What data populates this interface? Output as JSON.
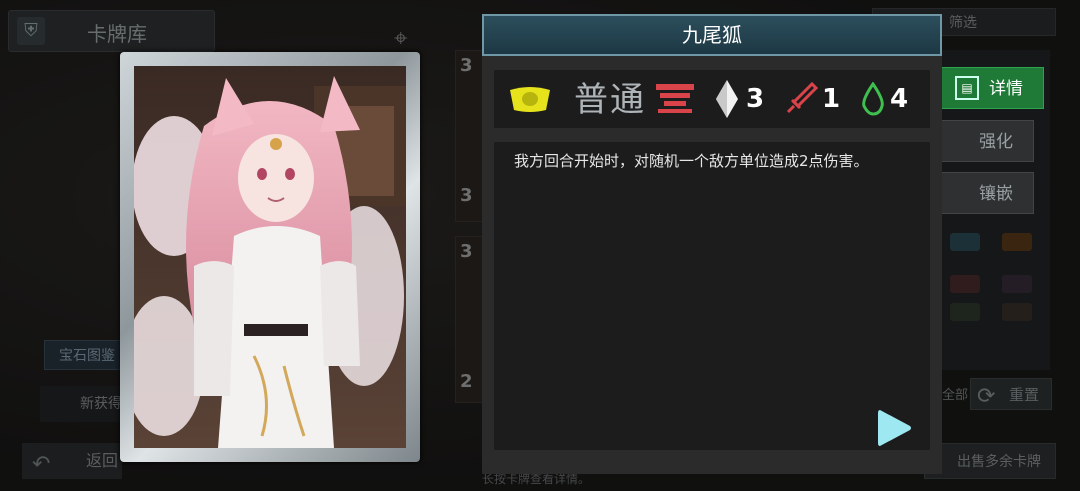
{
  "header": {
    "title": "卡牌库"
  },
  "filter": {
    "label": "筛选"
  },
  "card": {
    "name": "九尾狐",
    "rarity": "普通",
    "cost": "3",
    "attack": "1",
    "health": "4",
    "description": "我方回合开始时，对随机一个敌方单位造成2点伤害。"
  },
  "side_buttons": {
    "detail": "详情",
    "enhance": "强化",
    "inlay": "镶嵌"
  },
  "background": {
    "card_numbers": [
      "3",
      "3",
      "3",
      "2"
    ],
    "gem_book": "宝石图鉴",
    "new_get": "新获得",
    "all_label": "全部",
    "reset": "重置",
    "sell": "出售多余卡牌",
    "back": "返回",
    "hint": "长按卡牌查看详情。"
  },
  "colors": {
    "accent_green": "#1f7a37",
    "title_bar": "#2c4e5c",
    "attack_red": "#d8444a",
    "health_green": "#3fbf4f"
  }
}
